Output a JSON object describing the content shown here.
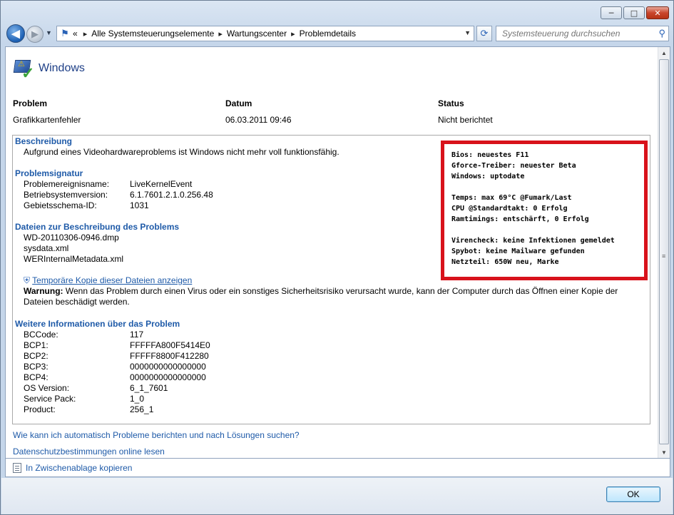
{
  "window": {
    "caption_buttons": {
      "minimize": "─",
      "maximize": "□",
      "close": "✕"
    }
  },
  "nav": {
    "overflow": "«",
    "breadcrumbs": [
      "Alle Systemsteuerungselemente",
      "Wartungscenter",
      "Problemdetails"
    ],
    "search_placeholder": "Systemsteuerung durchsuchen"
  },
  "header": {
    "title": "Windows"
  },
  "summary": {
    "problem_label": "Problem",
    "problem_value": "Grafikkartenfehler",
    "date_label": "Datum",
    "date_value": "06.03.2011 09:46",
    "status_label": "Status",
    "status_value": "Nicht berichtet"
  },
  "description": {
    "title": "Beschreibung",
    "text": "Aufgrund eines Videohardwareproblems ist Windows nicht mehr voll funktionsfähig."
  },
  "signature": {
    "title": "Problemsignatur",
    "rows": [
      {
        "key": "Problemereignisname:",
        "value": "LiveKernelEvent"
      },
      {
        "key": "Betriebsystemversion:",
        "value": "6.1.7601.2.1.0.256.48"
      },
      {
        "key": "Gebietsschema-ID:",
        "value": "1031"
      }
    ]
  },
  "files": {
    "title": "Dateien zur Beschreibung des Problems",
    "items": [
      "WD-20110306-0946.dmp",
      "sysdata.xml",
      "WERInternalMetadata.xml"
    ],
    "view_link": "Temporäre Kopie dieser Dateien anzeigen",
    "warning_label": "Warnung:",
    "warning_text": "Wenn das Problem durch einen Virus oder ein sonstiges Sicherheitsrisiko verursacht wurde, kann der Computer durch das Öffnen einer Kopie der",
    "warning_text2": "Dateien beschädigt werden."
  },
  "more_info": {
    "title": "Weitere Informationen über das Problem",
    "rows": [
      {
        "key": "BCCode:",
        "value": "117"
      },
      {
        "key": "BCP1:",
        "value": "FFFFFA800F5414E0"
      },
      {
        "key": "BCP2:",
        "value": "FFFFF8800F412280"
      },
      {
        "key": "BCP3:",
        "value": "0000000000000000"
      },
      {
        "key": "BCP4:",
        "value": "0000000000000000"
      },
      {
        "key": "OS Version:",
        "value": "6_1_7601"
      },
      {
        "key": "Service Pack:",
        "value": "1_0"
      },
      {
        "key": "Product:",
        "value": "256_1"
      }
    ]
  },
  "links": {
    "auto_report": "Wie kann ich automatisch Probleme berichten und nach Lösungen suchen?",
    "privacy": "Datenschutzbestimmungen online lesen",
    "copy_clipboard": "In Zwischenablage kopieren"
  },
  "overlay_note": {
    "lines": [
      "Bios: neuestes F11",
      "Gforce-Treiber: neuester Beta",
      "Windows: uptodate",
      "",
      "Temps: max 69°C @Fumark/Last",
      "CPU @Standardtakt: 0 Erfolg",
      "Ramtimings: entschärft, 0 Erfolg",
      "",
      "Virencheck: keine Infektionen gemeldet",
      "Spybot: keine Mailware gefunden",
      "Netzteil: 650W neu, Marke"
    ],
    "border_color": "#d8121b"
  },
  "footer": {
    "ok_label": "OK"
  }
}
